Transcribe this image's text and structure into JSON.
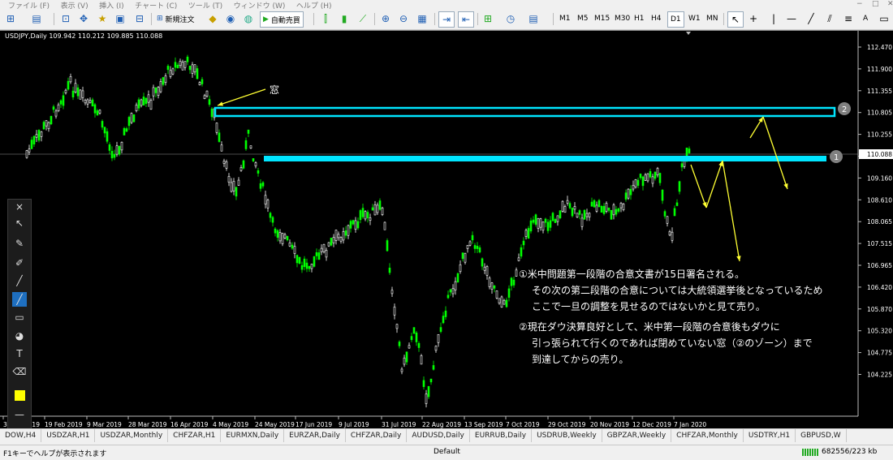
{
  "menu": {
    "items": [
      "ファイル (F)",
      "表示 (V)",
      "挿入 (I)",
      "チャート (C)",
      "ツール (T)",
      "ウィンドウ (W)",
      "ヘルプ (H)"
    ],
    "window_controls": [
      "−",
      "□",
      "✕"
    ]
  },
  "toolbar": {
    "new_order_label": "新規注文",
    "auto_trade_label": "自動売買",
    "timeframes": [
      "M1",
      "M5",
      "M15",
      "M30",
      "H1",
      "H4",
      "D1",
      "W1",
      "MN"
    ],
    "active_timeframe": "D1"
  },
  "chart": {
    "symbol_info": "USDJPY,Daily  109.942 110.212 109.885 110.088",
    "current_price_label": "110.088",
    "window_label": "窓",
    "zone1_marker": "1",
    "zone2_marker": "2",
    "bull_color": "#00ff00",
    "zone_color": "#00e5ff",
    "arrow_color": "#ffff33",
    "y_ticks": [
      "112.470",
      "111.900",
      "111.355",
      "110.805",
      "110.255",
      "109.710",
      "109.160",
      "108.610",
      "108.065",
      "107.515",
      "106.965",
      "106.420",
      "105.870",
      "105.320",
      "104.775",
      "104.225"
    ],
    "x_ticks": [
      "31 Jan 2019",
      "19 Feb 2019",
      "9 Mar 2019",
      "28 Mar 2019",
      "16 Apr 2019",
      "4 May 2019",
      "24 May 2019",
      "17 Jun 2019",
      "9 Jul 2019",
      "31 Jul 2019",
      "22 Aug 2019",
      "13 Sep 2019",
      "7 Oct 2019",
      "29 Oct 2019",
      "20 Nov 2019",
      "12 Dec 2019",
      "7 Jan 2020"
    ]
  },
  "annotation": {
    "line1": "①米中問題第一段階の合意文書が15日署名される。",
    "line2": "その次の第二段階の合意については大統領選挙後となっているため",
    "line3": "ここで一旦の調整を見せるのではないかと見て売り。",
    "line4": "②現在ダウ決算良好として、米中第一段階の合意後もダウに",
    "line5": "引っ張られて行くのであれば閉めていない窓（②のゾーン）まで",
    "line6": "到達してからの売り。"
  },
  "tabs": [
    "DOW,H4",
    "USDZAR,H1",
    "USDZAR,Monthly",
    "CHFZAR,H1",
    "EURMXN,Daily",
    "EURZAR,Daily",
    "CHFZAR,Daily",
    "AUDUSD,Daily",
    "EURRUB,Daily",
    "USDRUB,Weekly",
    "GBPZAR,Weekly",
    "CHFZAR,Monthly",
    "USDTRY,H1",
    "GBPUSD,W"
  ],
  "status": {
    "help": "F1キーでヘルプが表示されます",
    "profile": "Default",
    "traffic": "682556/223 kb"
  }
}
